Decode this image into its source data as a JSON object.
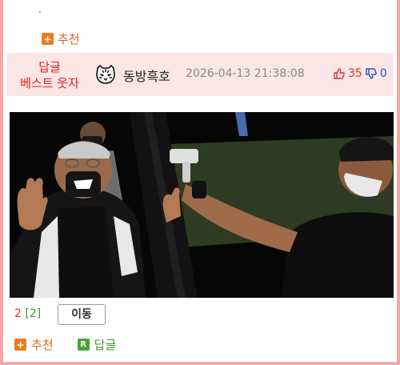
{
  "top": {
    "dot": "·",
    "recommend_label": "추천"
  },
  "comment": {
    "badge_line1": "답글",
    "badge_line2": "베스트 웃자",
    "nickname": "동방흑호",
    "timestamp": "2026-04-13 21:38:08",
    "upvotes": "35",
    "downvotes": "0",
    "avatar_icon": "tiger-icon",
    "colors": {
      "badge": "#e01f1f",
      "upvote": "#e03030",
      "downvote": "#2a4fd0",
      "header_bg": "#fbe6e6"
    }
  },
  "footer": {
    "count": "2",
    "reply_count": "[2]",
    "move_label": "이동",
    "recommend_label": "추천",
    "reply_label": "답글"
  }
}
